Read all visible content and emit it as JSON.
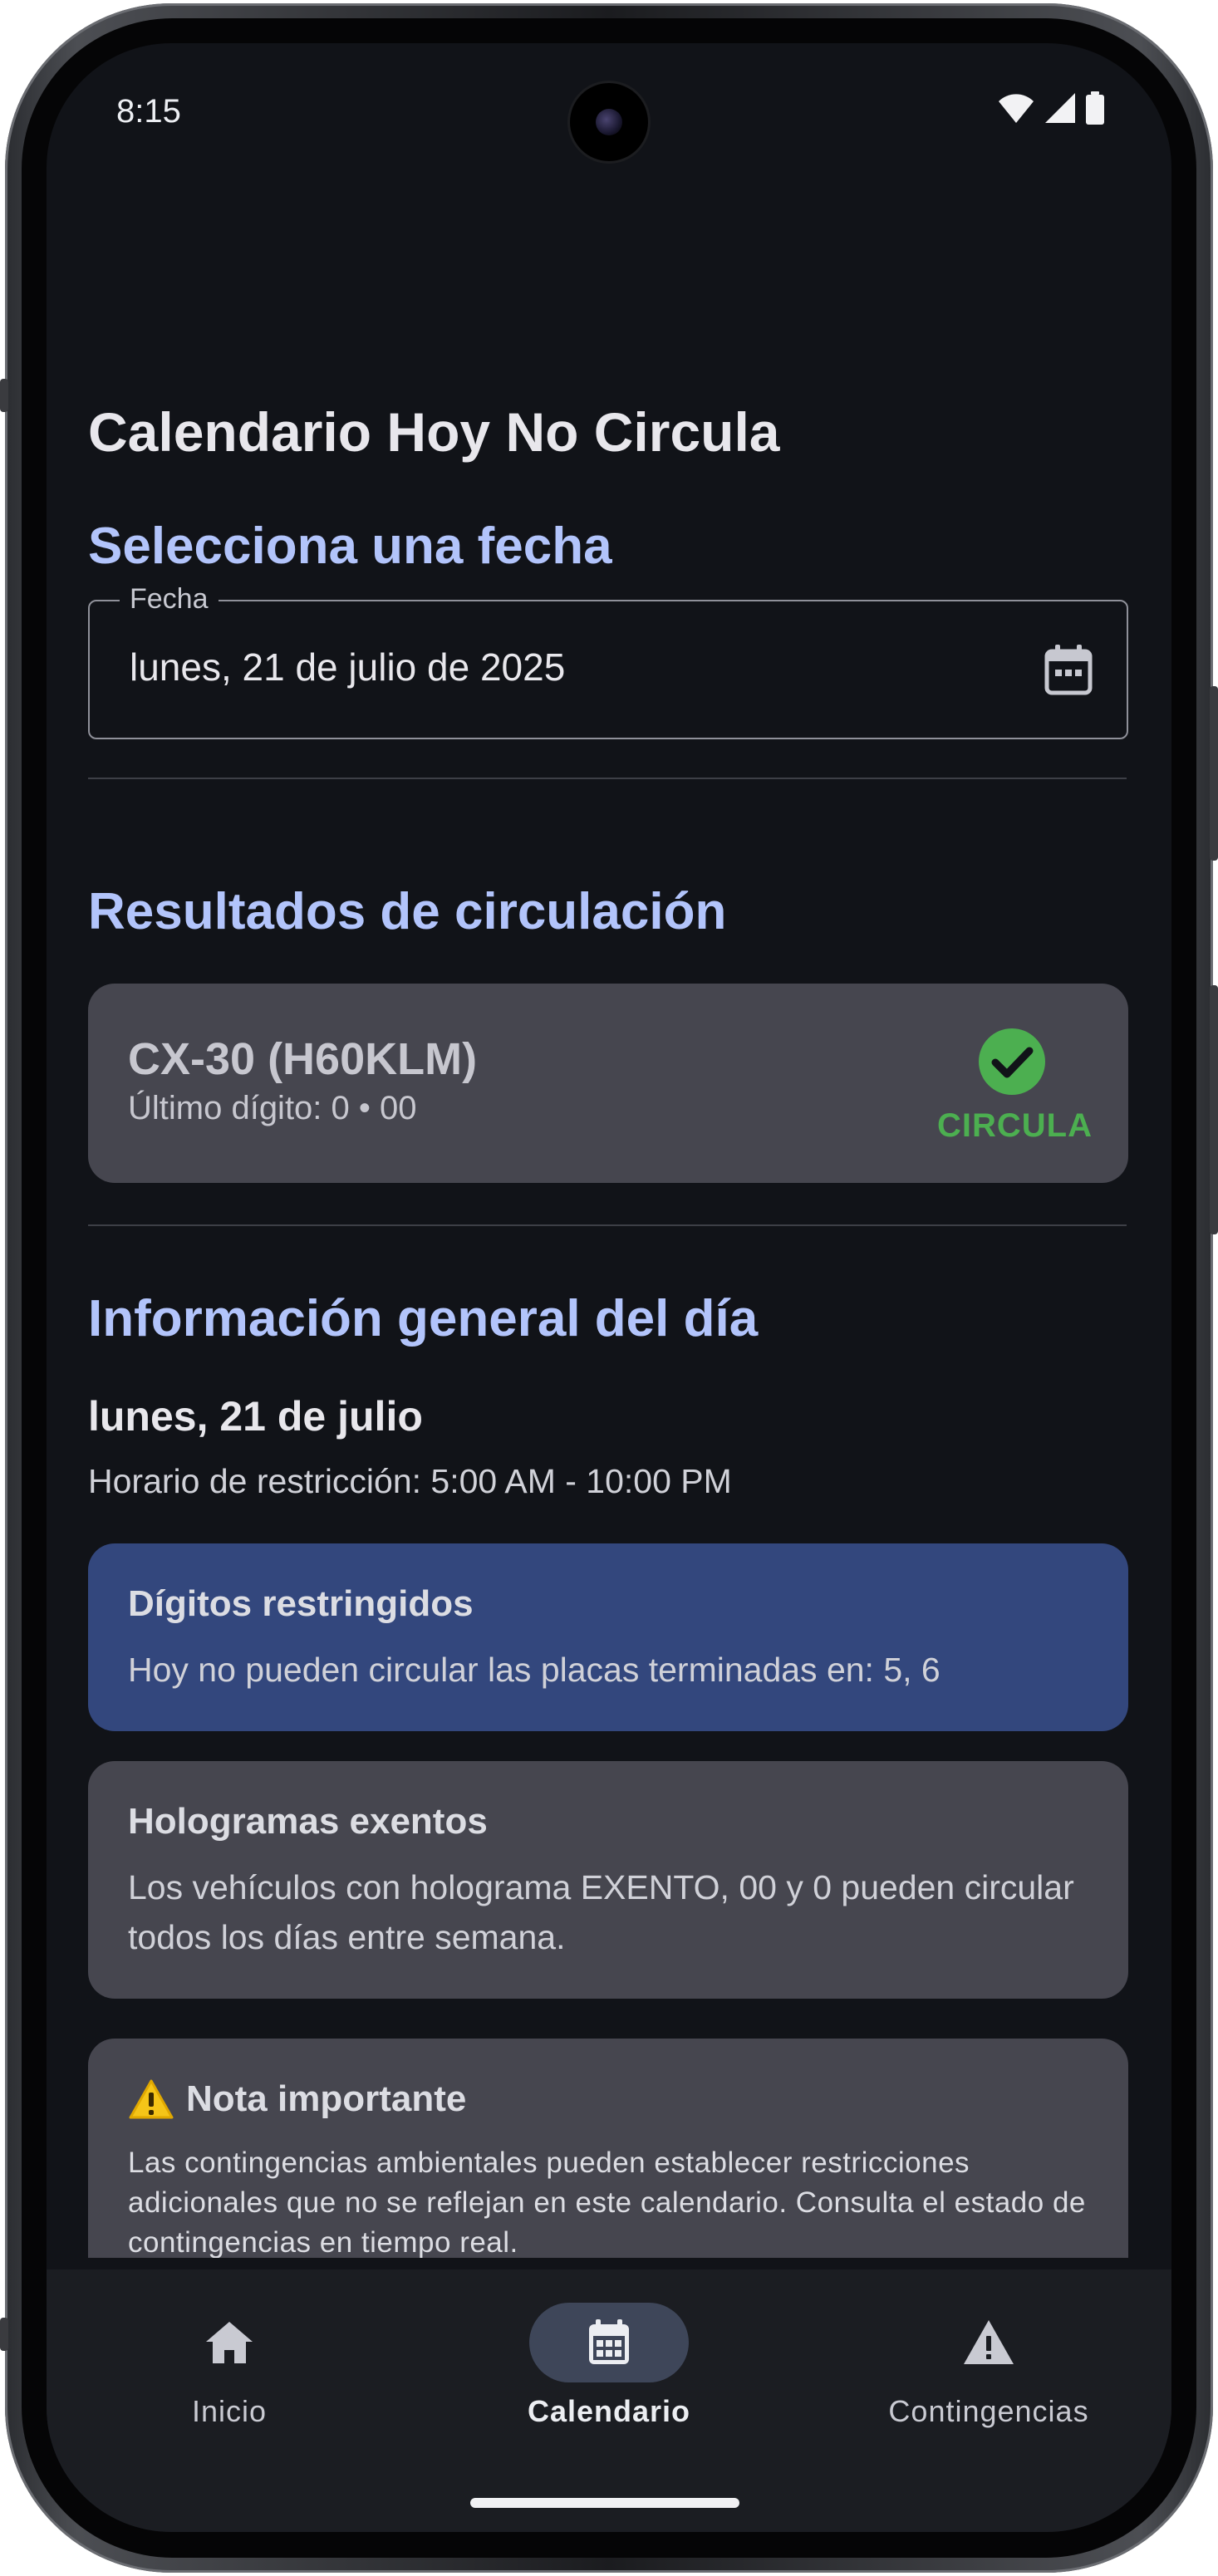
{
  "status_bar": {
    "time": "8:15"
  },
  "page_title": "Calendario Hoy No Circula",
  "date_section": {
    "title": "Selecciona una fecha",
    "field_label": "Fecha",
    "field_value": "lunes, 21 de julio de 2025",
    "icon": "calendar-icon"
  },
  "results_section": {
    "title": "Resultados de circulación",
    "vehicle": {
      "name": "CX-30 (H60KLM)",
      "detail": "Último dígito: 0 • 00",
      "status": "CIRCULA",
      "status_icon": "check-circle-icon",
      "status_color": "#4caf50"
    }
  },
  "general_section": {
    "title": "Información general del día",
    "day": "lunes, 21 de julio",
    "schedule": "Horario de restricción: 5:00 AM - 10:00 PM",
    "restricted": {
      "title": "Dígitos restringidos",
      "text": "Hoy no pueden circular las placas terminadas en: 5, 6"
    },
    "exempt": {
      "title": "Hologramas exentos",
      "text": "Los vehículos con holograma EXENTO, 00 y 0 pueden circular todos los días entre semana."
    },
    "note": {
      "title": "Nota importante",
      "icon": "warning-icon",
      "text": "Las contingencias ambientales pueden establecer restricciones adicionales que no se reflejan en este calendario. Consulta el estado de contingencias en tiempo real."
    }
  },
  "bottom_nav": {
    "items": [
      {
        "label": "Inicio",
        "icon": "home-icon",
        "active": false
      },
      {
        "label": "Calendario",
        "icon": "calendar-icon",
        "active": true
      },
      {
        "label": "Contingencias",
        "icon": "warning-icon",
        "active": false
      }
    ]
  },
  "colors": {
    "background": "#111318",
    "accent_title": "#b2c4fb",
    "card_gray": "#46464f",
    "card_blue": "#33477d",
    "success": "#4caf50"
  }
}
